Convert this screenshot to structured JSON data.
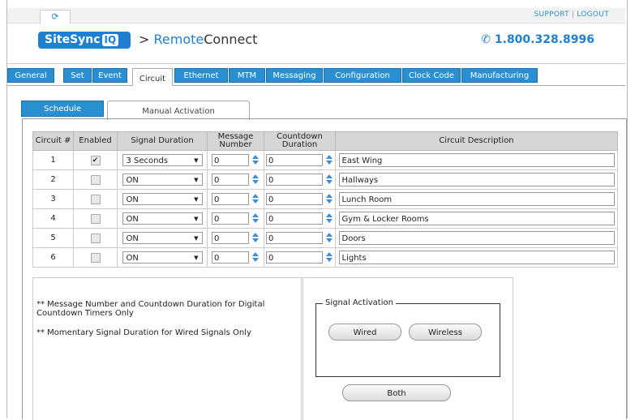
{
  "topbar": {
    "support": "SUPPORT",
    "logout": "LOGOUT",
    "home_icon": "home-arrow-icon"
  },
  "header": {
    "logo_main": "SiteSync",
    "logo_iq": "IQ",
    "brand_sep": ">",
    "brand_remote": "Remote",
    "brand_connect": "Connect",
    "phone": "✆ 1.800.328.8996"
  },
  "tabs": [
    "General",
    "Set",
    "Event",
    "Circuit",
    "Ethernet",
    "MTM",
    "Messaging",
    "Configuration",
    "Clock Code",
    "Manufacturing"
  ],
  "active_tab": "Circuit",
  "subtabs": {
    "schedule": "Schedule",
    "manual": "Manual Activation"
  },
  "table": {
    "headers": {
      "circuit": "Circuit #",
      "enabled": "Enabled",
      "signal_duration": "Signal Duration",
      "message_number": "Message Number",
      "countdown_duration": "Countdown Duration",
      "description": "Circuit Description"
    },
    "rows": [
      {
        "circuit": "1",
        "enabled": "✔",
        "signal": "3 Seconds",
        "message": "0",
        "countdown": "0",
        "description": "East Wing"
      },
      {
        "circuit": "2",
        "enabled": "",
        "signal": "ON",
        "message": "0",
        "countdown": "0",
        "description": "Hallways"
      },
      {
        "circuit": "3",
        "enabled": "",
        "signal": "ON",
        "message": "0",
        "countdown": "0",
        "description": "Lunch Room"
      },
      {
        "circuit": "4",
        "enabled": "",
        "signal": "ON",
        "message": "0",
        "countdown": "0",
        "description": "Gym & Locker Rooms"
      },
      {
        "circuit": "5",
        "enabled": "",
        "signal": "ON",
        "message": "0",
        "countdown": "0",
        "description": "Doors"
      },
      {
        "circuit": "6",
        "enabled": "",
        "signal": "ON",
        "message": "0",
        "countdown": "0",
        "description": "Lights"
      }
    ]
  },
  "notes": {
    "note1": "** Message Number and Countdown Duration for Digital Countdown Timers Only",
    "note2": "** Momentary Signal Duration for Wired Signals Only"
  },
  "activation": {
    "legend": "Signal Activation",
    "wired": "Wired",
    "wireless": "Wireless",
    "both": "Both"
  },
  "colors": {
    "accent": "#2a8fd0",
    "header_bg": "#d6d6d6"
  }
}
